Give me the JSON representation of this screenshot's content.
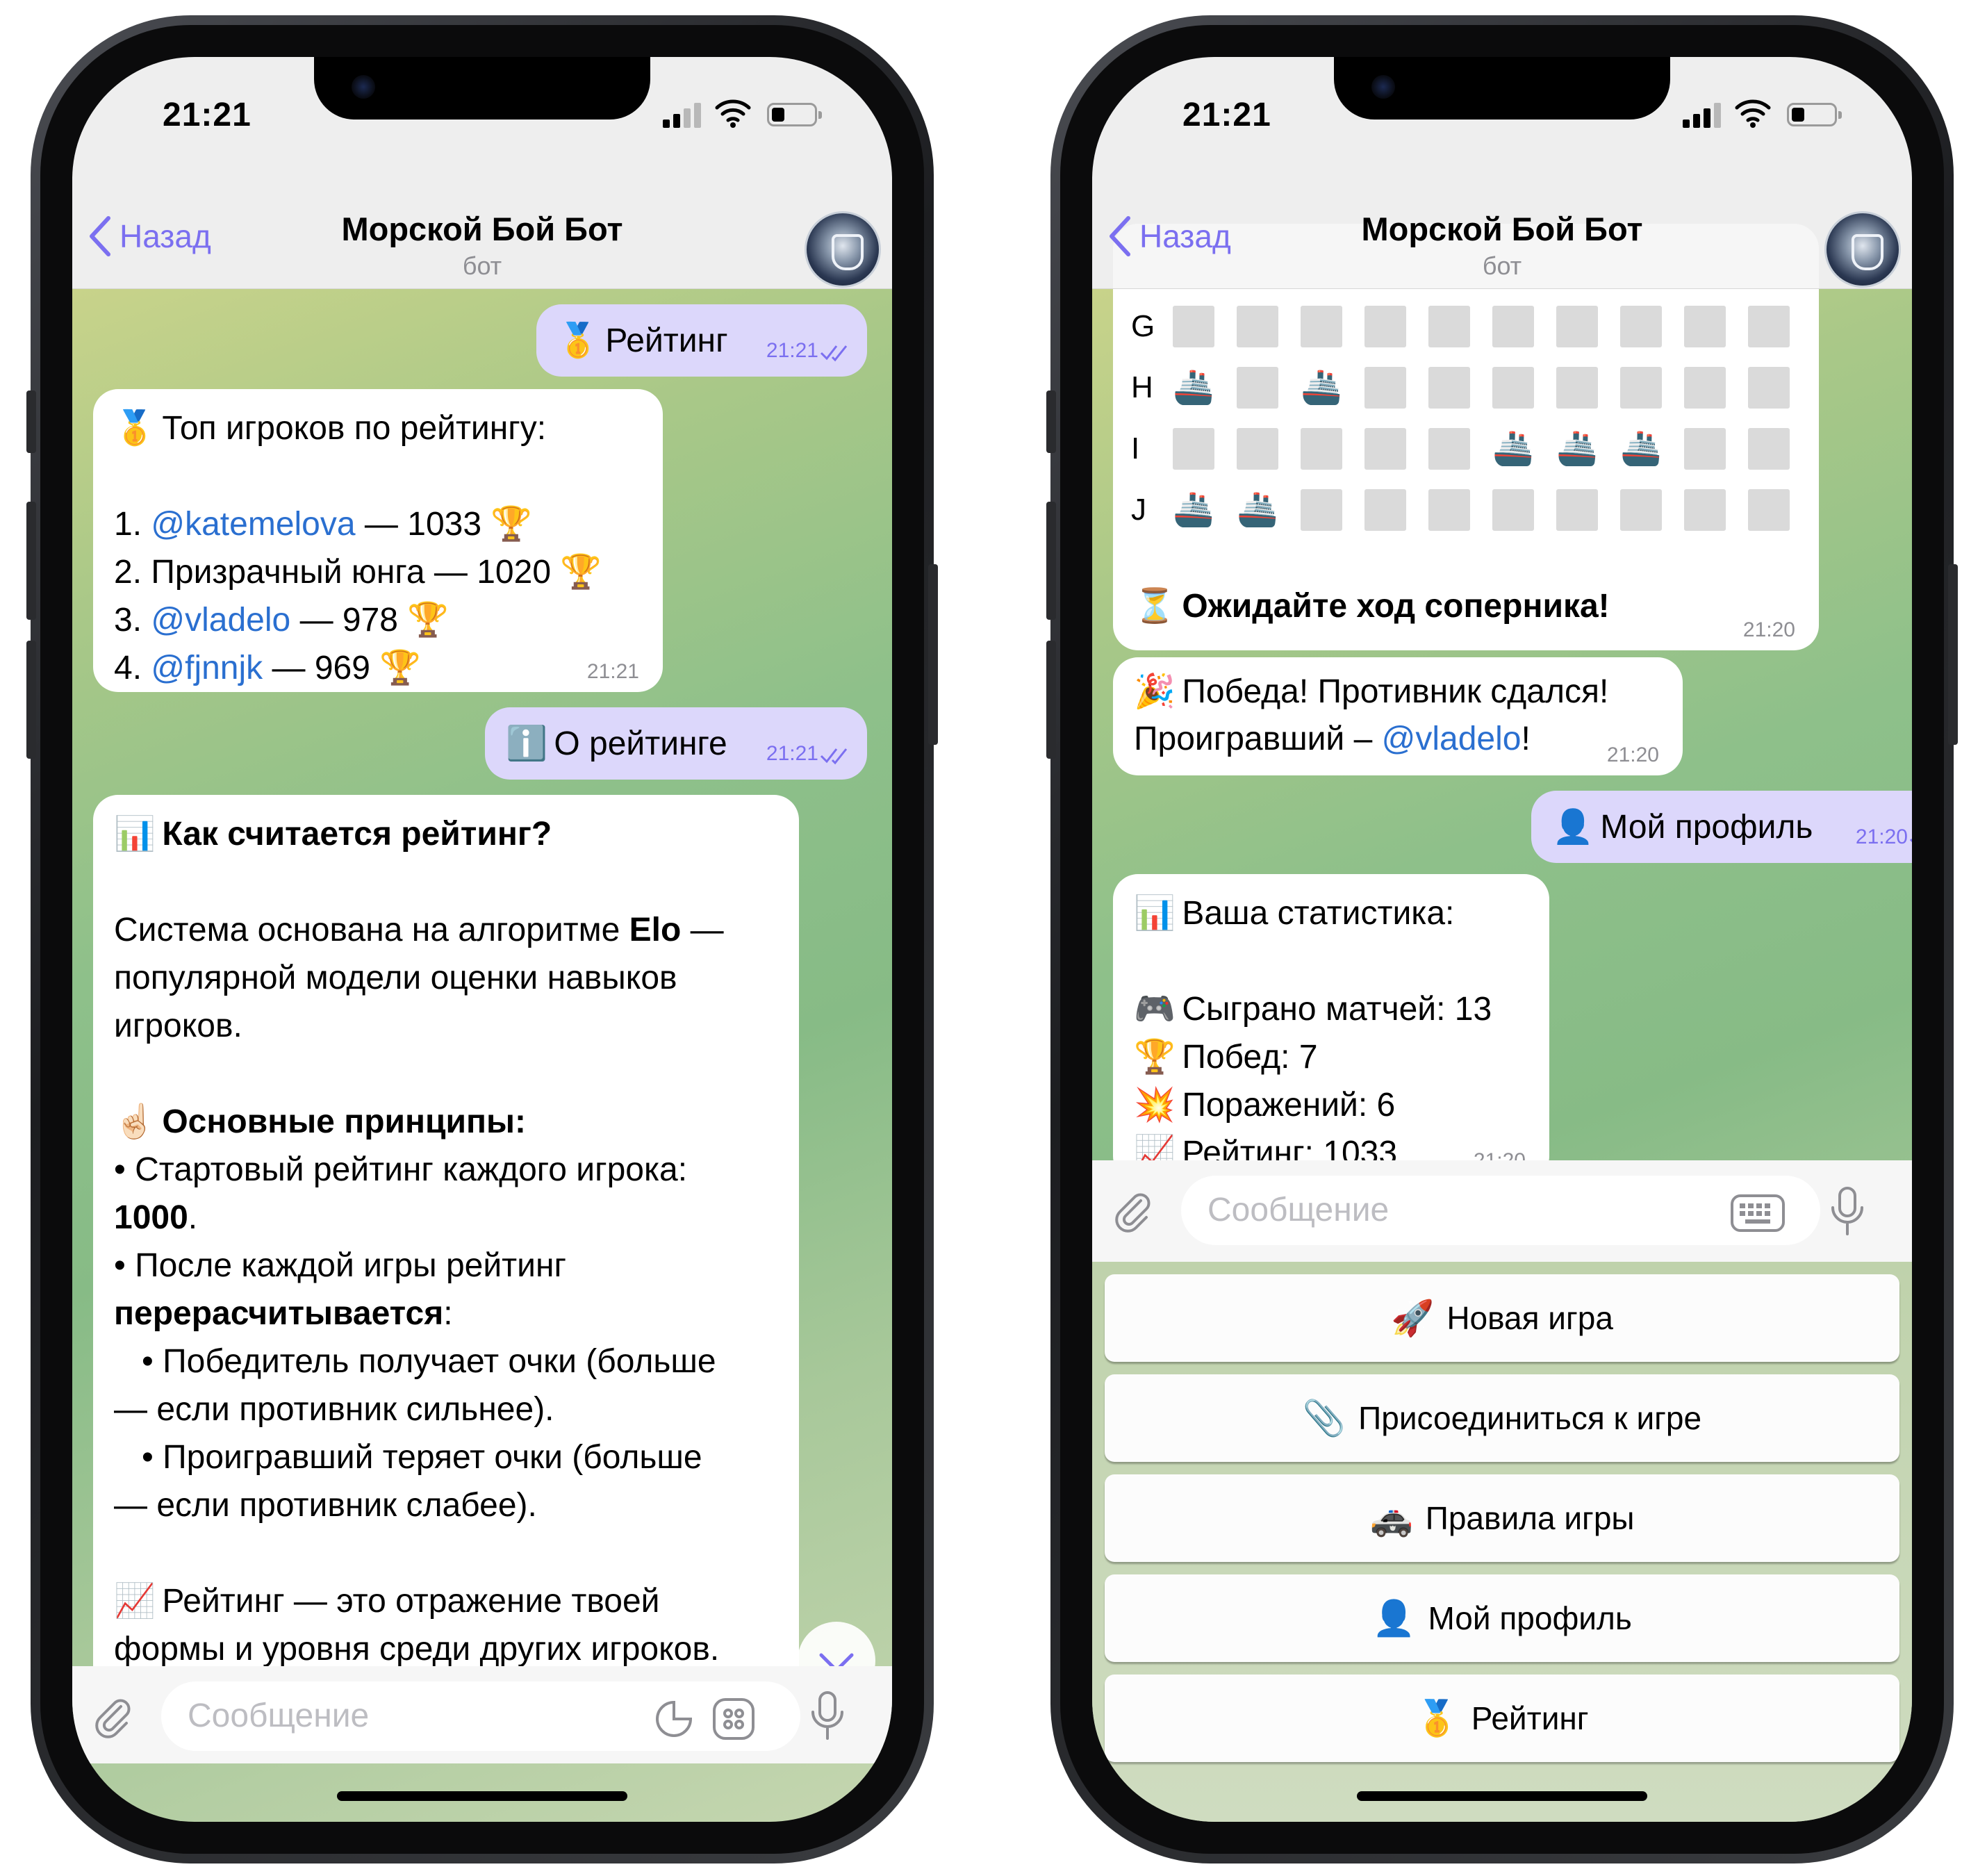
{
  "status": {
    "time": "21:21"
  },
  "header": {
    "back": "Назад",
    "title": "Морской Бой Бот",
    "subtitle": "бот"
  },
  "left": {
    "msg_rating_cmd": {
      "icon": "🥇",
      "text": "Рейтинг",
      "time": "21:21"
    },
    "top_list": {
      "icon": "🥇",
      "heading": "Топ игроков по рейтингу:",
      "rows": [
        {
          "num": "1.",
          "name": "@katemelova",
          "score": "— 1033",
          "icon": "🏆"
        },
        {
          "num": "2.",
          "name": "Призрачный юнга",
          "score": "— 1020",
          "icon": "🏆"
        },
        {
          "num": "3.",
          "name": "@vladelo",
          "score": "— 978",
          "icon": "🏆"
        },
        {
          "num": "4.",
          "name": "@fjnnjk",
          "score": "— 969",
          "icon": "🏆"
        }
      ],
      "time": "21:21"
    },
    "msg_about_cmd": {
      "icon": "ℹ️",
      "text": "О рейтинге",
      "time": "21:21"
    },
    "about": {
      "icon": "📊",
      "heading": "Как считается рейтинг?",
      "p1_a": "Система основана на алгоритме ",
      "p1_b": "Elo",
      "p1_c": " —",
      "p1_line2": "популярной модели оценки навыков",
      "p1_line3": "игроков.",
      "principles_icon": "☝🏻",
      "principles_heading": "Основные принципы:",
      "b1_line1": "• Стартовый рейтинг каждого игрока:",
      "b1_value": "1000",
      "b1_tail": ".",
      "b2_line1": "• После каждой игры рейтинг",
      "b2_bold": "перерасчитывается",
      "b2_tail": ":",
      "s1_line1": "   • Победитель получает очки (больше",
      "s1_line2": "— если противник сильнее).",
      "s2_line1": "   • Проигравший теряет очки (больше",
      "s2_line2": "— если противник слабее).",
      "footer_icon": "📈",
      "footer_line1": "Рейтинг — это отражение твоей",
      "footer_line2": "формы и уровня среди других игроков."
    },
    "composer_placeholder": "Сообщение"
  },
  "right": {
    "board": {
      "rows": [
        {
          "label": "G",
          "cells": "..........",
          "ship_emoji": "🚢"
        },
        {
          "label": "H",
          "cells": "S.S.......",
          "ship_emoji": "🚢"
        },
        {
          "label": "I",
          "cells": ".....SSS..",
          "ship_emoji": "🚢"
        },
        {
          "label": "J",
          "cells": "SS........",
          "ship_emoji": "🚢"
        }
      ],
      "wait_icon": "⏳",
      "wait_text": "Ожидайте ход соперника!",
      "time": "21:20"
    },
    "victory": {
      "icon": "🎉",
      "line1": "Победа! Противник сдался!",
      "line2_a": "Проигравший – ",
      "line2_mention": "@vladelo",
      "line2_b": "!",
      "time": "21:20"
    },
    "msg_profile_cmd": {
      "icon": "👤",
      "text": "Мой профиль",
      "time": "21:20"
    },
    "stats": {
      "icon": "📊",
      "heading": "Ваша статистика:",
      "rows": [
        {
          "icon": "🎮",
          "text": "Сыграно матчей: 13"
        },
        {
          "icon": "🏆",
          "text": "Побед: 7"
        },
        {
          "icon": "💥",
          "text": "Поражений: 6"
        },
        {
          "icon": "📈",
          "text": "Рейтинг: 1033"
        }
      ],
      "time": "21:20"
    },
    "composer_placeholder": "Сообщение",
    "keyboard": [
      {
        "icon": "🚀",
        "label": "Новая игра"
      },
      {
        "icon": "📎",
        "label": "Присоединиться к игре"
      },
      {
        "icon": "🚓",
        "label": "Правила игры"
      },
      {
        "icon": "👤",
        "label": "Мой профиль"
      },
      {
        "icon": "🥇",
        "label": "Рейтинг"
      }
    ]
  },
  "colors": {
    "accent": "#7b6ff0",
    "mention": "#2a6fd0",
    "outgoing": "#dcd7fb",
    "incoming": "#ffffff"
  }
}
